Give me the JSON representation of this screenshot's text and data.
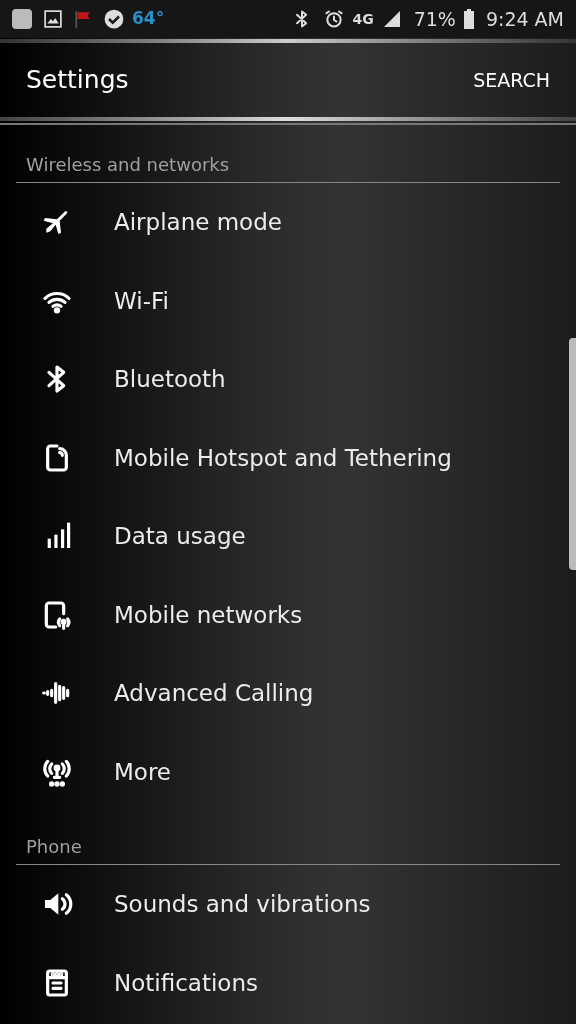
{
  "status_bar": {
    "temperature": "64°",
    "network": "4G",
    "battery": "71%",
    "time": "9:24 AM"
  },
  "header": {
    "title": "Settings",
    "action": "SEARCH"
  },
  "sections": [
    {
      "title": "Wireless and networks",
      "items": [
        {
          "label": "Airplane mode",
          "kind": "airplane"
        },
        {
          "label": "Wi-Fi",
          "kind": "wifi"
        },
        {
          "label": "Bluetooth",
          "kind": "bluetooth"
        },
        {
          "label": "Mobile Hotspot and Tethering",
          "kind": "hotspot"
        },
        {
          "label": "Data usage",
          "kind": "bars"
        },
        {
          "label": "Mobile networks",
          "kind": "mobile"
        },
        {
          "label": "Advanced Calling",
          "kind": "wave"
        },
        {
          "label": "More",
          "kind": "antenna"
        }
      ]
    },
    {
      "title": "Phone",
      "items": [
        {
          "label": "Sounds and vibrations",
          "kind": "sound"
        },
        {
          "label": "Notifications",
          "kind": "notif"
        }
      ]
    }
  ]
}
